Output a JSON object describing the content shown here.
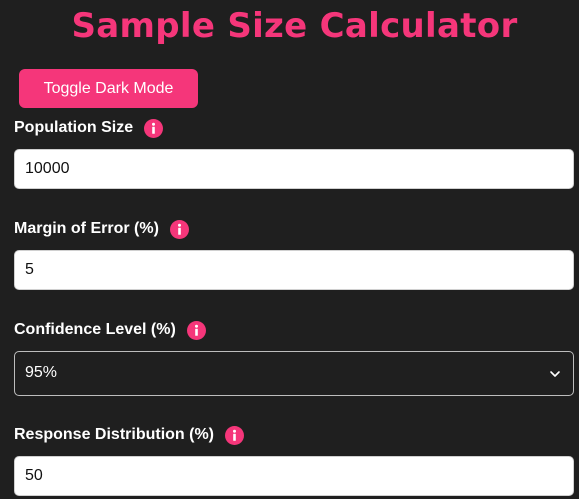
{
  "header": {
    "title": "Sample Size Calculator"
  },
  "toggle_button": {
    "label": "Toggle Dark Mode"
  },
  "fields": {
    "population": {
      "label": "Population Size",
      "value": "10000"
    },
    "margin": {
      "label": "Margin of Error (%)",
      "value": "5"
    },
    "confidence": {
      "label": "Confidence Level (%)",
      "value": "95%"
    },
    "distribution": {
      "label": "Response Distribution (%)",
      "value": "50"
    }
  },
  "icons": {
    "info": "info-icon",
    "select_arrow": "chevron-down-icon"
  },
  "colors": {
    "accent": "#f5367a",
    "background": "#1f1f1f",
    "input_background": "#ffffff",
    "text": "#ffffff"
  }
}
